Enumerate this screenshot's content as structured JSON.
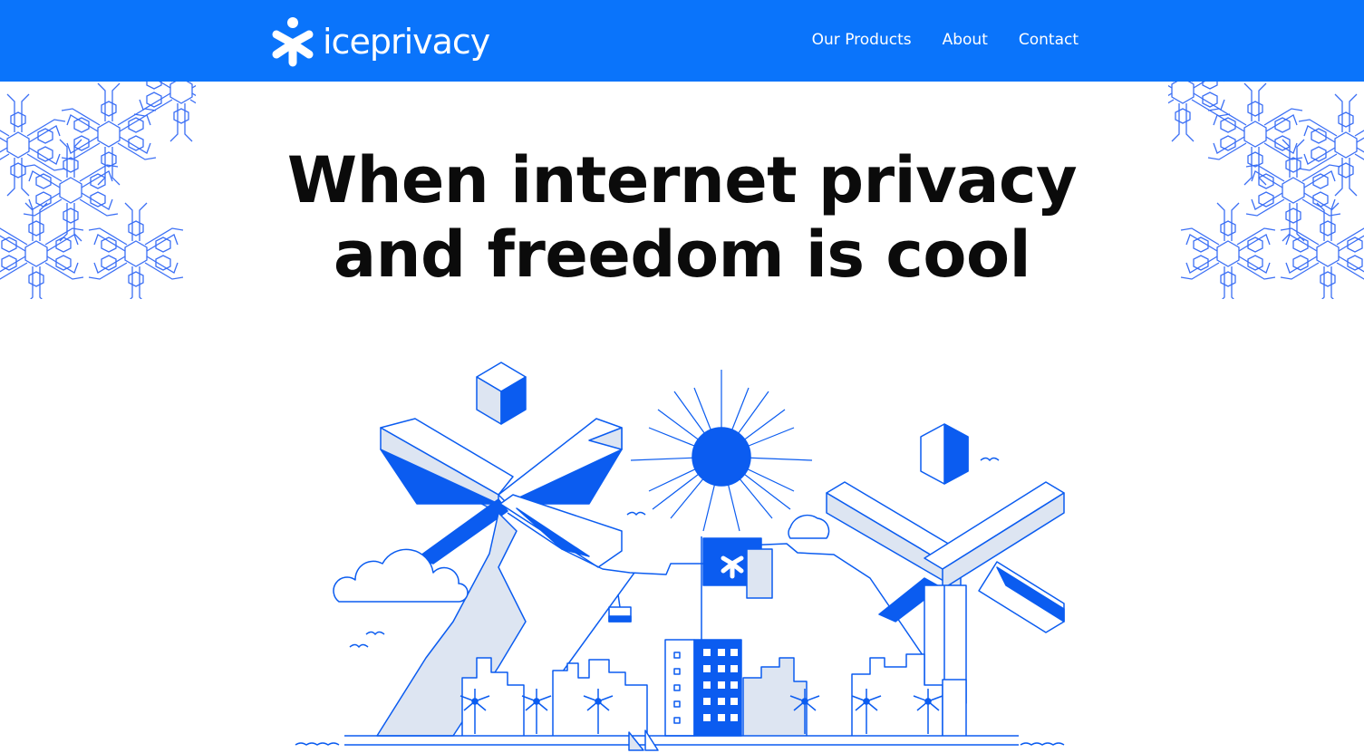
{
  "header": {
    "logo_text": "iceprivacy",
    "logo_icon": "snowflake-asterisk-icon",
    "nav": [
      {
        "label": "Our Products"
      },
      {
        "label": "About"
      },
      {
        "label": "Contact"
      }
    ]
  },
  "hero": {
    "headline_line1": "When internet privacy",
    "headline_line2": "and freedom is cool",
    "illustration_icons": [
      "snowflake-pattern",
      "sun-icon",
      "cloud-icon",
      "flag-icon",
      "cable-car-icon",
      "palm-tree-icon",
      "building-icon",
      "bird-icon",
      "sailboat-icon"
    ]
  },
  "colors": {
    "brand_blue": "#0a74fb",
    "illustration_blue": "#0b5cf0",
    "illustration_fill": "#dde5f2",
    "text": "#0b0b0b",
    "background": "#ffffff"
  }
}
